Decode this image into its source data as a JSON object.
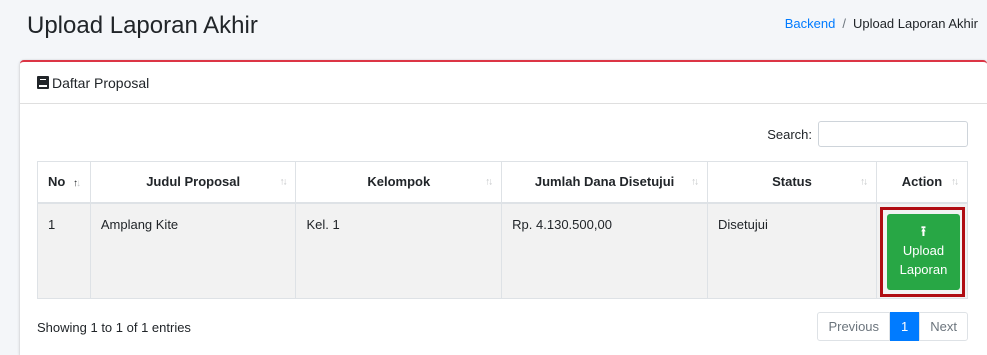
{
  "header": {
    "title": "Upload Laporan Akhir",
    "breadcrumb": {
      "link": "Backend",
      "separator": "/",
      "active": "Upload Laporan Akhir"
    }
  },
  "card": {
    "title": "Daftar Proposal",
    "icon": "book-icon",
    "accent_color": "#dc3545"
  },
  "search": {
    "label": "Search:",
    "value": "",
    "placeholder": ""
  },
  "table": {
    "columns": [
      "No",
      "Judul Proposal",
      "Kelompok",
      "Jumlah Dana Disetujui",
      "Status",
      "Action"
    ],
    "rows": [
      {
        "no": "1",
        "judul": "Amplang Kite",
        "kelompok": "Kel. 1",
        "dana": "Rp. 4.130.500,00",
        "status": "Disetujui",
        "action_label": "Upload Laporan",
        "action_icon": "upload-icon"
      }
    ]
  },
  "footer": {
    "info": "Showing 1 to 1 of 1 entries",
    "pagination": {
      "previous": "Previous",
      "current": "1",
      "next": "Next"
    }
  }
}
